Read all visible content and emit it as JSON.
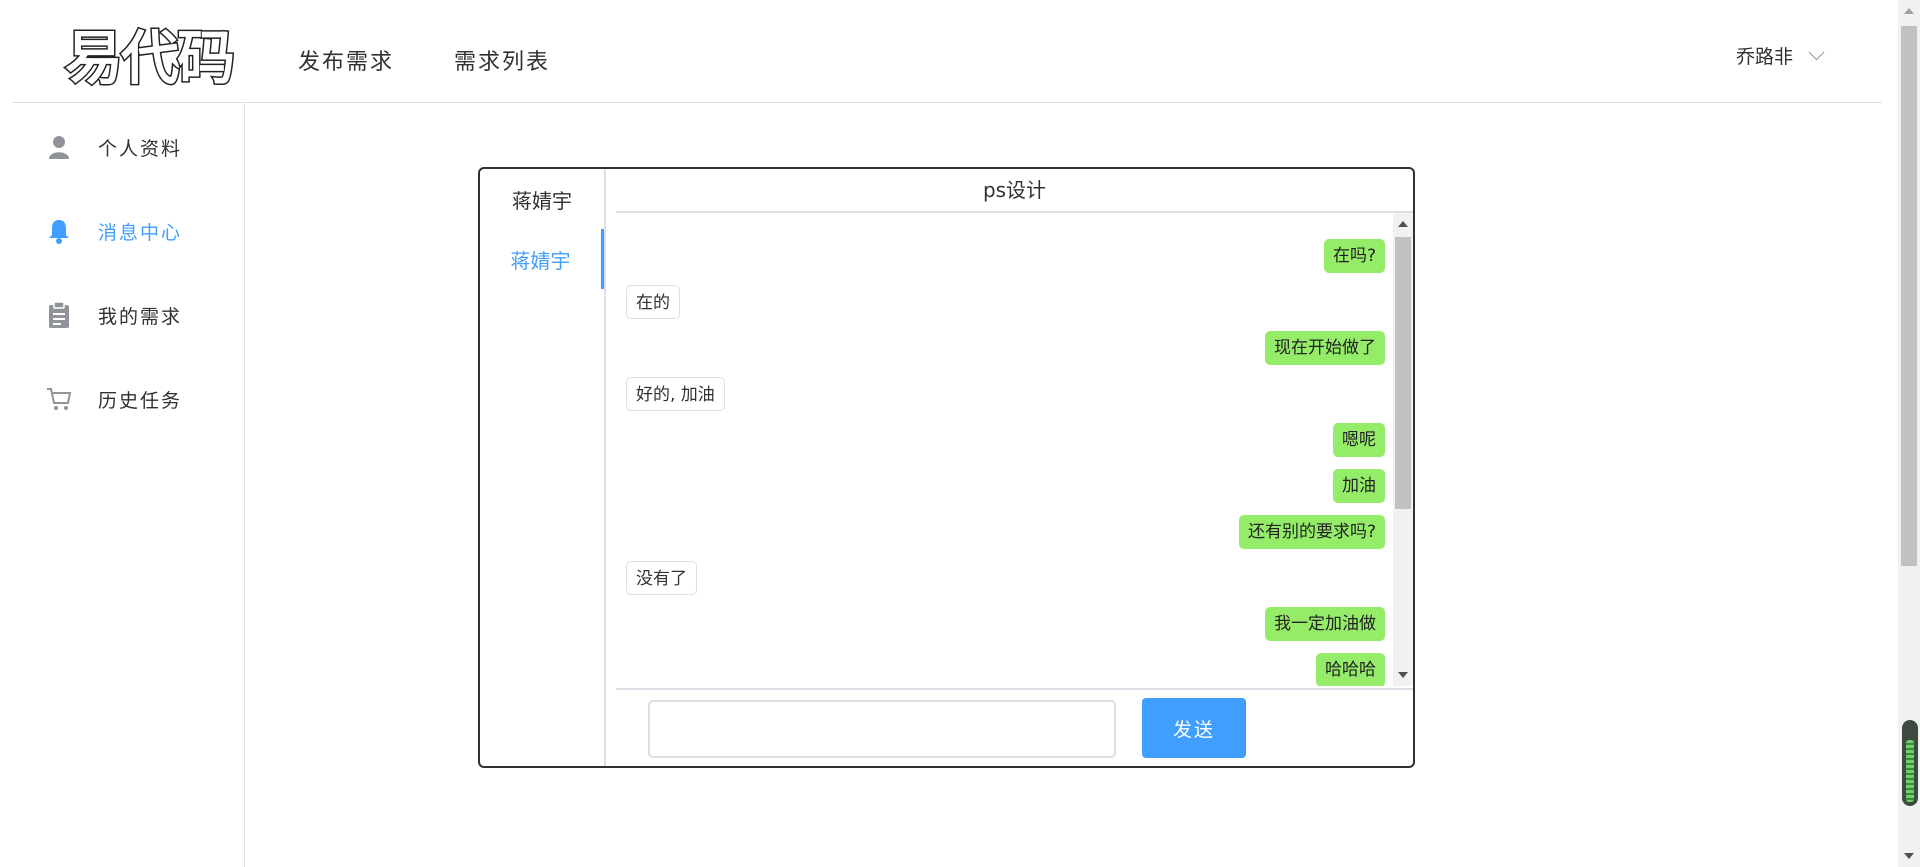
{
  "header": {
    "logo_text": "易代码",
    "nav": [
      "发布需求",
      "需求列表"
    ],
    "username": "乔路非"
  },
  "sidebar": {
    "items": [
      {
        "label": "个人资料",
        "icon": "user-icon"
      },
      {
        "label": "消息中心",
        "icon": "bell-icon",
        "active": true
      },
      {
        "label": "我的需求",
        "icon": "clipboard-icon"
      },
      {
        "label": "历史任务",
        "icon": "cart-icon"
      }
    ]
  },
  "chat": {
    "contacts": [
      {
        "name": "蒋婧宇"
      },
      {
        "name": "蒋婧宇",
        "active": true
      }
    ],
    "title": "ps设计",
    "messages": [
      {
        "from": "me",
        "text": "在吗?"
      },
      {
        "from": "other",
        "text": "在的"
      },
      {
        "from": "me",
        "text": "现在开始做了"
      },
      {
        "from": "other",
        "text": "好的, 加油"
      },
      {
        "from": "me",
        "text": "嗯呢"
      },
      {
        "from": "me",
        "text": "加油"
      },
      {
        "from": "me",
        "text": "还有别的要求吗?"
      },
      {
        "from": "other",
        "text": "没有了"
      },
      {
        "from": "me",
        "text": "我一定加油做"
      },
      {
        "from": "me",
        "text": "哈哈哈"
      }
    ],
    "input_value": "",
    "send_label": "发送"
  },
  "colors": {
    "accent": "#409eff",
    "my_bubble": "#95ec69",
    "border": "#dcdfe6"
  }
}
